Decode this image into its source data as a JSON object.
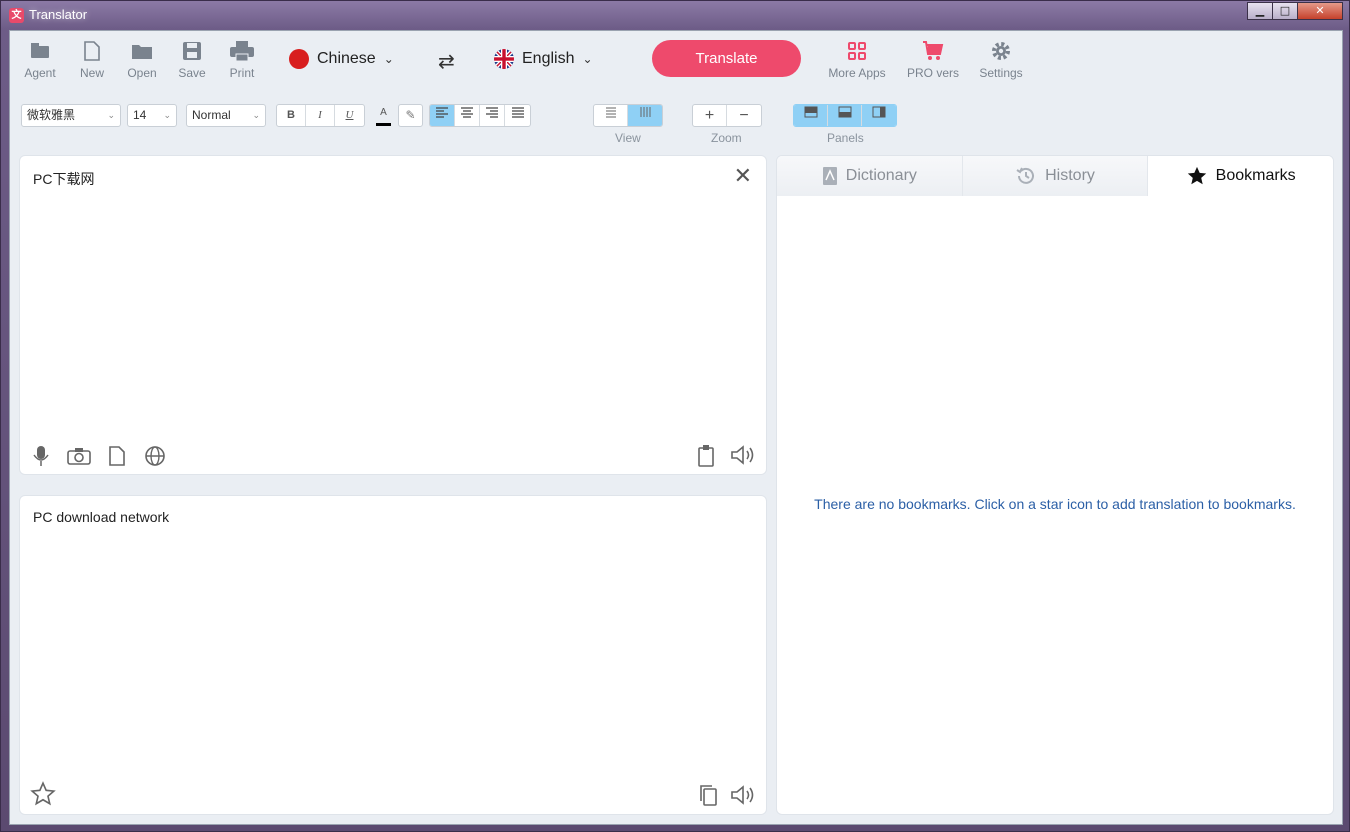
{
  "window": {
    "title": "Translator",
    "minimize": "▁",
    "maximize": "□",
    "close": "✕"
  },
  "toolbar": {
    "agent": "Agent",
    "new": "New",
    "open": "Open",
    "save": "Save",
    "print": "Print",
    "source_lang": "Chinese",
    "target_lang": "English",
    "translate": "Translate",
    "more_apps": "More Apps",
    "pro": "PRO vers",
    "settings": "Settings"
  },
  "format": {
    "font": "微软雅黑",
    "size": "14",
    "style": "Normal",
    "bold": "B",
    "italic": "I",
    "underline": "U",
    "font_color": "A",
    "view_label": "View",
    "zoom_label": "Zoom",
    "panels_label": "Panels",
    "zoom_in": "+",
    "zoom_out": "−"
  },
  "source": {
    "text": "PC下载网"
  },
  "target": {
    "text": "PC download network"
  },
  "side_panel": {
    "tabs": [
      "Dictionary",
      "History",
      "Bookmarks"
    ],
    "active_tab": "Bookmarks",
    "empty_message": "There are no bookmarks. Click on a star icon to add translation to bookmarks."
  },
  "colors": {
    "accent": "#ee4a6c",
    "toggle_on": "#8fd0f5",
    "link": "#2b5fa6"
  }
}
